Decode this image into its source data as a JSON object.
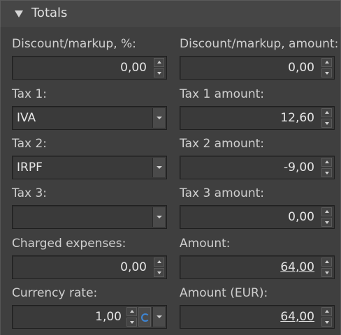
{
  "section": {
    "title": "Totals"
  },
  "fields": {
    "discount_pct": {
      "label": "Discount/markup, %:",
      "value": "0,00"
    },
    "discount_amount": {
      "label": "Discount/markup, amount:",
      "value": "0,00"
    },
    "tax1": {
      "label": "Tax 1:",
      "value": "IVA"
    },
    "tax1_amount": {
      "label": "Tax 1 amount:",
      "value": "12,60"
    },
    "tax2": {
      "label": "Tax 2:",
      "value": "IRPF"
    },
    "tax2_amount": {
      "label": "Tax 2 amount:",
      "value": "-9,00"
    },
    "tax3": {
      "label": "Tax 3:",
      "value": ""
    },
    "tax3_amount": {
      "label": "Tax 3 amount:",
      "value": "0,00"
    },
    "charged_expenses": {
      "label": "Charged expenses:",
      "value": "0,00"
    },
    "amount": {
      "label": "Amount:",
      "value": "64,00"
    },
    "currency_rate": {
      "label": "Currency rate:",
      "value": "1,00"
    },
    "amount_eur": {
      "label": "Amount (EUR):",
      "value": "64,00"
    }
  },
  "icons": {
    "collapse": "triangle-down-icon",
    "spin_up": "chevron-up-icon",
    "spin_down": "chevron-down-icon",
    "dropdown": "chevron-down-icon",
    "refresh": "refresh-icon"
  }
}
